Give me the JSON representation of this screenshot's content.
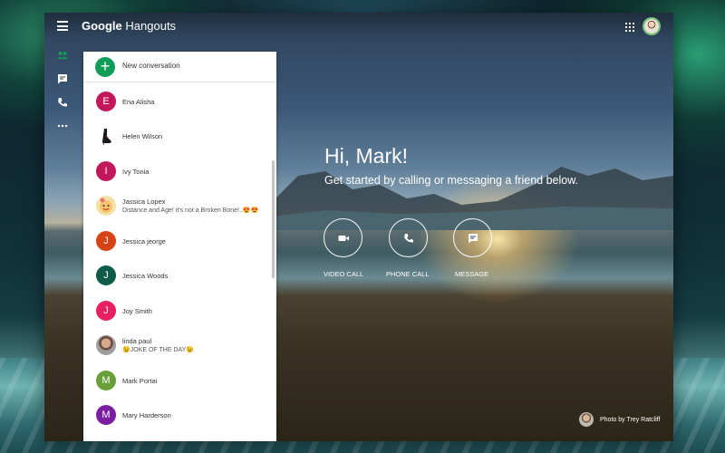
{
  "app": {
    "title_brand": "Google",
    "title_product": "Hangouts"
  },
  "sidebar": {
    "items": [
      {
        "name": "contacts",
        "icon": "people-icon"
      },
      {
        "name": "conversations",
        "icon": "chat-icon"
      },
      {
        "name": "phone-calls",
        "icon": "phone-icon"
      },
      {
        "name": "more",
        "icon": "more-horizontal-icon"
      }
    ]
  },
  "conversations": {
    "new_label": "New conversation",
    "items": [
      {
        "name": "Ena Alisha",
        "initial": "E",
        "color": "#c2185b"
      },
      {
        "name": "Helen Wilson",
        "initial": "",
        "color": "#ffffff"
      },
      {
        "name": "Ivy Tonia",
        "initial": "I",
        "color": "#c2185b"
      },
      {
        "name": "Jassica Lopex",
        "initial": "",
        "color": "#f4e1a6",
        "preview": "Distance and Age! it's not a Broken Bone!..😍😍"
      },
      {
        "name": "Jessica jeorge",
        "initial": "J",
        "color": "#d84315"
      },
      {
        "name": "Jessica Woods",
        "initial": "J",
        "color": "#0d5c4a"
      },
      {
        "name": "Joy Smith",
        "initial": "J",
        "color": "#e91e63"
      },
      {
        "name": "linda paul",
        "initial": "",
        "color": "#8d6e63",
        "preview": "😉JOKE OF THE DAY😉"
      },
      {
        "name": "Mark Portai",
        "initial": "M",
        "color": "#689f38"
      },
      {
        "name": "Mary Harderson",
        "initial": "M",
        "color": "#7b1fa2"
      }
    ]
  },
  "hero": {
    "title": "Hi, Mark!",
    "subtitle": "Get started by calling or messaging a friend below."
  },
  "actions": [
    {
      "label": "VIDEO CALL",
      "icon": "videocam-icon"
    },
    {
      "label": "PHONE CALL",
      "icon": "phone-icon"
    },
    {
      "label": "MESSAGE",
      "icon": "message-icon"
    }
  ],
  "photo_credit": "Photo by Trey Ratcliff",
  "colors": {
    "accent_green": "#0f9d58"
  }
}
